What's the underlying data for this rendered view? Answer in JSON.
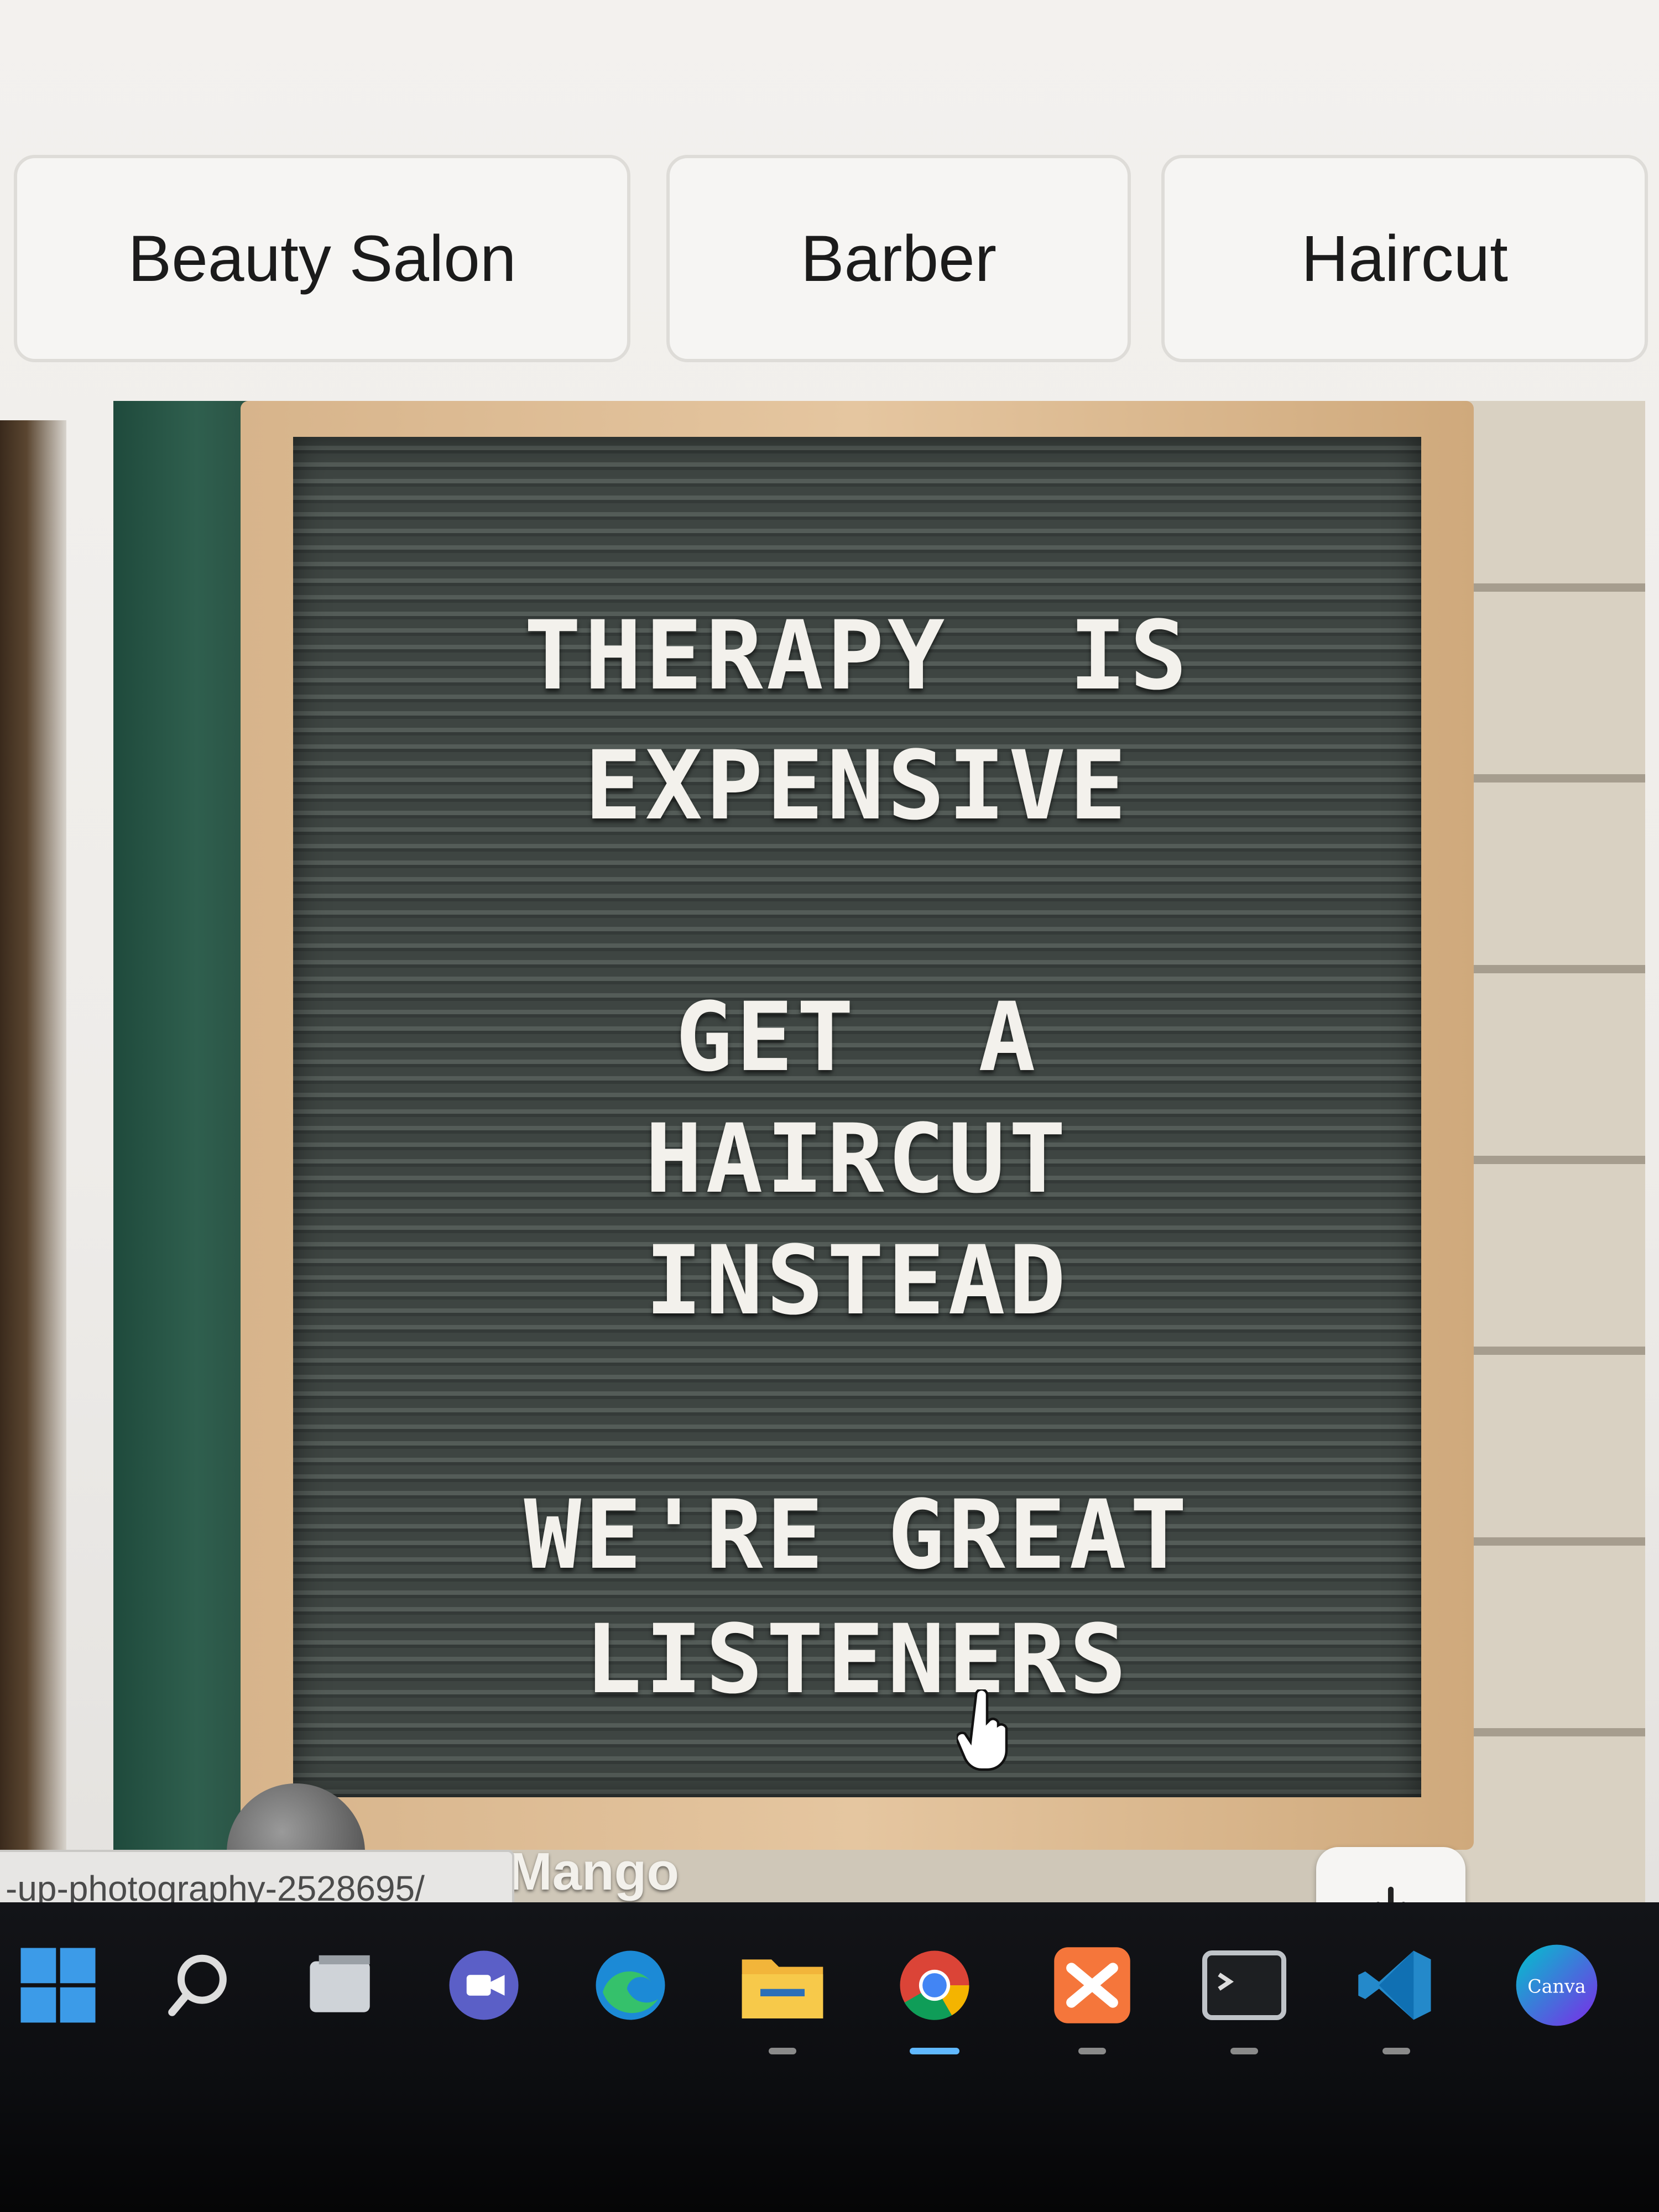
{
  "filter_chips": [
    {
      "label": "Beauty Salon"
    },
    {
      "label": "Barber"
    },
    {
      "label": "Haircut"
    }
  ],
  "photo": {
    "sign_lines": [
      "THERAPY  IS",
      "EXPENSIVE",
      "GET  A",
      "HAIRCUT",
      "INSTEAD",
      "WE'RE GREAT",
      "LISTENERS"
    ],
    "author_name": "Mati Mango",
    "download_icon": "download-icon"
  },
  "status_url": "-up-photography-2528695/",
  "taskbar": {
    "items": [
      {
        "icon": "windows-start-icon"
      },
      {
        "icon": "search-icon"
      },
      {
        "icon": "task-view-icon"
      },
      {
        "icon": "teams-meet-icon"
      },
      {
        "icon": "edge-browser-icon"
      },
      {
        "icon": "file-explorer-icon"
      },
      {
        "icon": "chrome-browser-icon",
        "active": true
      },
      {
        "icon": "xampp-icon"
      },
      {
        "icon": "terminal-icon"
      },
      {
        "icon": "vscode-icon"
      },
      {
        "icon": "canva-icon",
        "label": "Canva"
      }
    ]
  },
  "colors": {
    "board": "#3e4542",
    "frame": "#d7b48b",
    "taskbar": "#0c0d10",
    "accent_active": "#60b8ff"
  }
}
